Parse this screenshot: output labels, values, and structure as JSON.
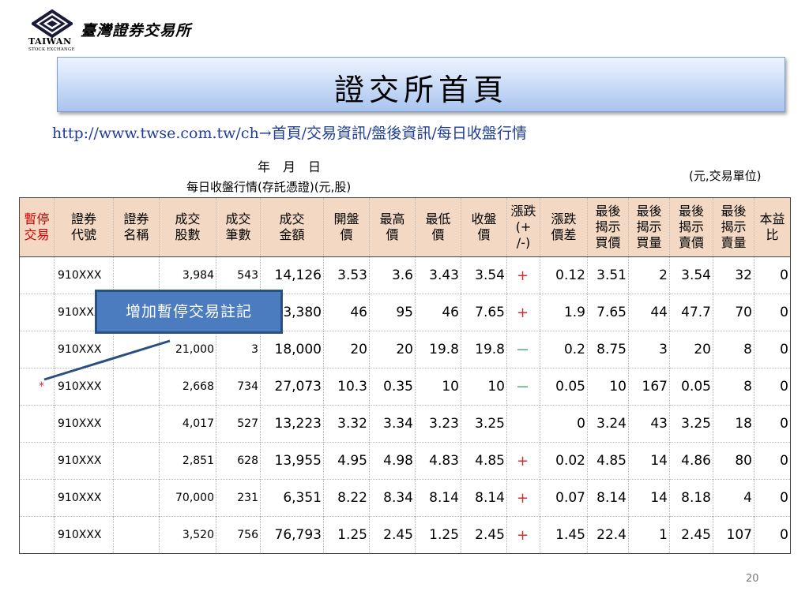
{
  "logo": {
    "brand_cn": "臺灣證券交易所",
    "brand_en": "TAIWAN",
    "brand_en_sub": "STOCK EXCHANGE"
  },
  "title": "證交所首頁",
  "url_path": "http://www.twse.com.tw/ch→首頁/交易資訊/盤後資訊/每日收盤行情",
  "date_line": "年　月　日",
  "caption": "每日收盤行情(存託憑證)(元,股)",
  "unit_note": "(元,交易單位)",
  "table": {
    "headers": [
      [
        "暫停",
        "交易"
      ],
      [
        "證券",
        "代號"
      ],
      [
        "證券",
        "名稱"
      ],
      [
        "成交",
        "股數"
      ],
      [
        "成交",
        "筆數"
      ],
      [
        "成交",
        "金額"
      ],
      [
        "開盤",
        "價"
      ],
      [
        "最高",
        "價"
      ],
      [
        "最低",
        "價"
      ],
      [
        "收盤",
        "價"
      ],
      [
        "漲跌",
        "(+",
        "/-)"
      ],
      [
        "漲跌",
        "價差"
      ],
      [
        "最後",
        "揭示",
        "買價"
      ],
      [
        "最後",
        "揭示",
        "買量"
      ],
      [
        "最後",
        "揭示",
        "賣價"
      ],
      [
        "最後",
        "揭示",
        "賣量"
      ],
      [
        "本益",
        "比"
      ]
    ],
    "rows": [
      [
        "",
        "910XXX",
        "",
        "3,984",
        "543",
        "14,126",
        "3.53",
        "3.6",
        "3.43",
        "3.54",
        "+",
        "0.12",
        "3.51",
        "2",
        "3.54",
        "32",
        "0"
      ],
      [
        "",
        "910XXX",
        "",
        "",
        "",
        "3,380",
        "46",
        "95",
        "46",
        "7.65",
        "+",
        "1.9",
        "7.65",
        "44",
        "47.7",
        "70",
        "0"
      ],
      [
        "",
        "910XXX",
        "",
        "21,000",
        "3",
        "18,000",
        "20",
        "20",
        "19.8",
        "19.8",
        "－",
        "0.2",
        "8.75",
        "3",
        "20",
        "8",
        "0"
      ],
      [
        "*",
        "910XXX",
        "",
        "2,668",
        "734",
        "27,073",
        "10.3",
        "0.35",
        "10",
        "10",
        "－",
        "0.05",
        "10",
        "167",
        "0.05",
        "8",
        "0"
      ],
      [
        "",
        "910XXX",
        "",
        "4,017",
        "527",
        "13,223",
        "3.32",
        "3.34",
        "3.23",
        "3.25",
        "",
        "0",
        "3.24",
        "43",
        "3.25",
        "18",
        "0"
      ],
      [
        "",
        "910XXX",
        "",
        "2,851",
        "628",
        "13,955",
        "4.95",
        "4.98",
        "4.83",
        "4.85",
        "+",
        "0.02",
        "4.85",
        "14",
        "4.86",
        "80",
        "0"
      ],
      [
        "",
        "910XXX",
        "",
        "70,000",
        "231",
        "6,351",
        "8.22",
        "8.34",
        "8.14",
        "8.14",
        "+",
        "0.07",
        "8.14",
        "14",
        "8.18",
        "4",
        "0"
      ],
      [
        "",
        "910XXX",
        "",
        "3,520",
        "756",
        "76,793",
        "1.25",
        "2.45",
        "1.25",
        "2.45",
        "+",
        "1.45",
        "22.4",
        "1",
        "2.45",
        "107",
        "0"
      ]
    ]
  },
  "callout_text": "增加暫停交易註記",
  "page_number": "20",
  "colors": {
    "header_bg": "#f3d9c4",
    "suspend_header": "#d00000",
    "plus": "#d23030",
    "minus": "#2e9a5a",
    "callout_bg": "#4b7cbf",
    "url": "#1f3d99"
  }
}
